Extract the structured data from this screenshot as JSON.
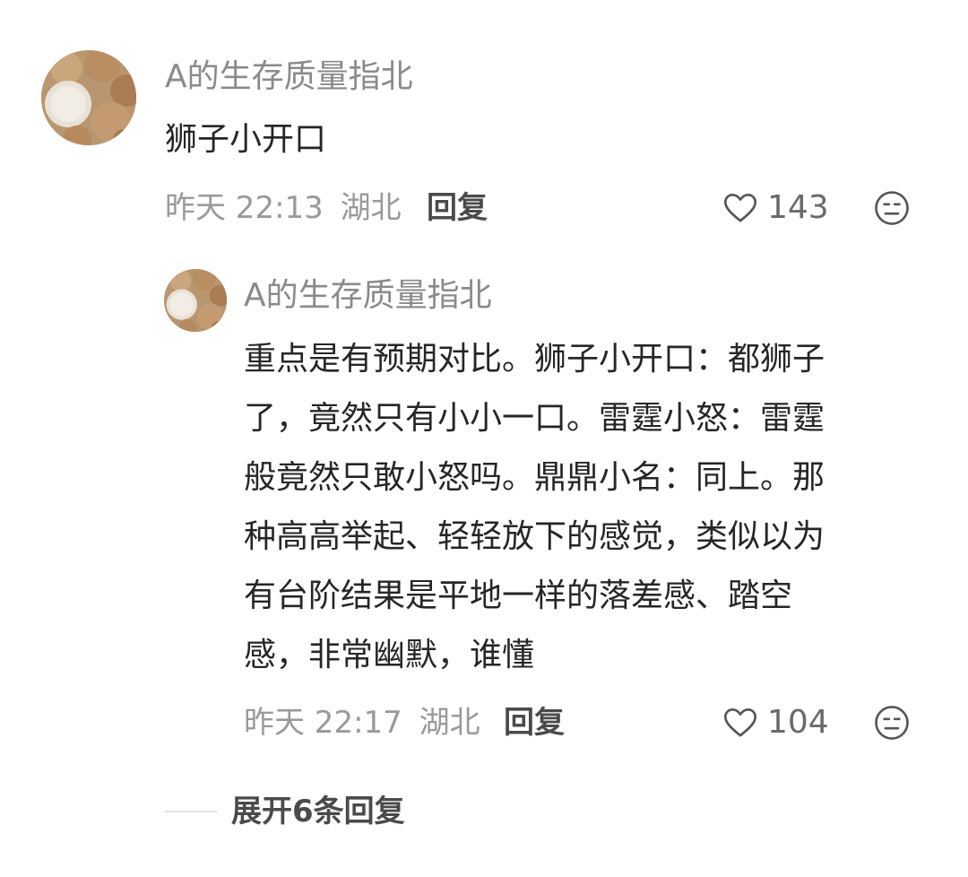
{
  "comment": {
    "username": "A的生存质量指北",
    "text": "狮子小开口",
    "time": "昨天 22:13",
    "location": "湖北",
    "reply_label": "回复",
    "like_count": "143",
    "avatar_icon": "avatar-bread-rolls",
    "like_icon": "heart-outline-icon",
    "dislike_icon": "unhappy-face-icon"
  },
  "reply": {
    "username": "A的生存质量指北",
    "lines": [
      "重点是有预期对比。狮子小开口：都狮子",
      "了，竟然只有小小一口。雷霆小怒：雷霆",
      "般竟然只敢小怒吗。鼎鼎小名：同上。那",
      "种高高举起、轻轻放下的感觉，类似以为",
      "有台阶结果是平地一样的落差感、踏空",
      "感，非常幽默，谁懂"
    ],
    "time": "昨天 22:17",
    "location": "湖北",
    "reply_label": "回复",
    "like_count": "104"
  },
  "expand_replies": "展开6条回复"
}
